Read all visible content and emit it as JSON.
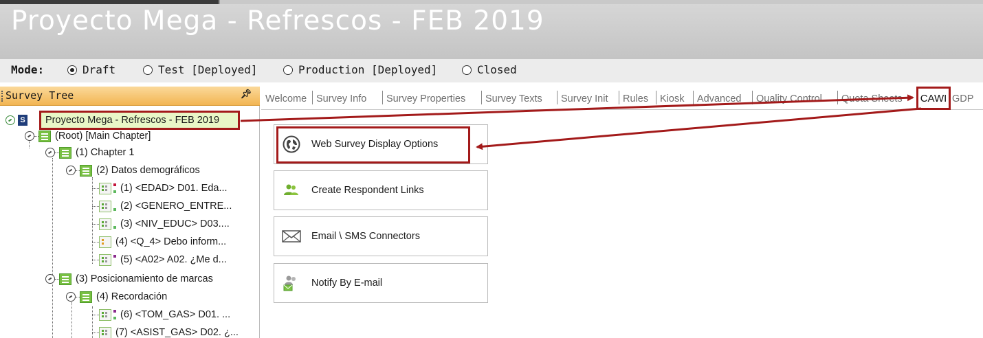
{
  "window": {
    "title": "Proyecto Mega - Refrescos - FEB 2019"
  },
  "mode": {
    "label": "Mode:",
    "options": [
      {
        "label": "Draft",
        "selected": true
      },
      {
        "label": "Test [Deployed]",
        "selected": false
      },
      {
        "label": "Production [Deployed]",
        "selected": false
      },
      {
        "label": "Closed",
        "selected": false
      }
    ]
  },
  "survey_tree": {
    "header": "Survey Tree",
    "pin_icon": "pin-icon",
    "survey_node": "Proyecto Mega - Refrescos - FEB 2019",
    "nodes": [
      {
        "label": "(Root) [Main Chapter]",
        "type": "chapter"
      },
      {
        "label": "(1) Chapter 1",
        "type": "chapter"
      },
      {
        "label": "(2) Datos demográficos",
        "type": "chapter"
      },
      {
        "label": "(1) <EDAD> D01. Eda...",
        "type": "question"
      },
      {
        "label": "(2) <GENERO_ENTRE...",
        "type": "question"
      },
      {
        "label": "(3) <NIV_EDUC> D03....",
        "type": "question"
      },
      {
        "label": "(4) <Q_4> Debo inform...",
        "type": "info"
      },
      {
        "label": "(5) <A02> A02. ¿Me d...",
        "type": "question"
      },
      {
        "label": "(3) Posicionamiento de marcas",
        "type": "chapter"
      },
      {
        "label": "(4) Recordación",
        "type": "chapter"
      },
      {
        "label": "(6) <TOM_GAS> D01. ...",
        "type": "question"
      },
      {
        "label": "(7) <ASIST_GAS> D02. ¿...",
        "type": "question"
      }
    ]
  },
  "tabs": [
    {
      "label": "Welcome"
    },
    {
      "label": "Survey Info"
    },
    {
      "label": "Survey Properties"
    },
    {
      "label": "Survey Texts"
    },
    {
      "label": "Survey Init"
    },
    {
      "label": "Rules"
    },
    {
      "label": "Kiosk"
    },
    {
      "label": "Advanced"
    },
    {
      "label": "Quality Control"
    },
    {
      "label": "Quota Sheets"
    },
    {
      "label": "CAWI",
      "active": true
    },
    {
      "label": "GDP"
    }
  ],
  "cawi_buttons": [
    {
      "label": "Web Survey Display Options",
      "icon": "globe-icon"
    },
    {
      "label": "Create Respondent Links",
      "icon": "users-icon"
    },
    {
      "label": "Email \\ SMS Connectors",
      "icon": "envelope-icon"
    },
    {
      "label": "Notify By E-mail",
      "icon": "notify-users-icon"
    }
  ],
  "colors": {
    "highlight": "#a31a1a",
    "tree_header": "#f2b552",
    "selected_node": "#e9f7c7",
    "chapter_icon": "#78c043"
  }
}
